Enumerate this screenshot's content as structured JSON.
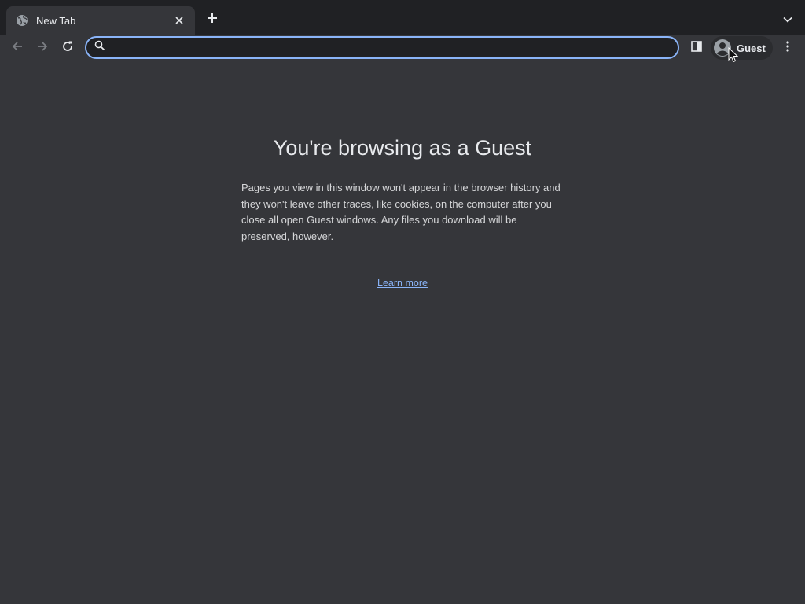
{
  "tabs": [
    {
      "title": "New Tab",
      "favicon_icon": "globe-icon",
      "close_icon": "close-icon",
      "active": true
    }
  ],
  "tabstrip": {
    "new_tab_icon": "plus-icon",
    "tab_search_icon": "chevron-down-icon"
  },
  "toolbar": {
    "back_icon": "arrow-left-icon",
    "forward_icon": "arrow-right-icon",
    "reload_icon": "reload-icon",
    "omnibox": {
      "icon": "search-icon",
      "value": "",
      "placeholder": ""
    },
    "side_panel_icon": "side-panel-icon",
    "profile": {
      "icon": "account-circle-icon",
      "label": "Guest"
    },
    "menu_icon": "more-vert-icon"
  },
  "content": {
    "heading": "You're browsing as a Guest",
    "description": "Pages you view in this window won't appear in the browser history and they won't leave other traces, like cookies, on the computer after you close all open Guest windows. Any files you download will be preserved, however.",
    "learn_more": "Learn more"
  },
  "colors": {
    "frame": "#202124",
    "toolbar": "#35363a",
    "accent": "#8ab4f8",
    "text": "#e8eaed"
  }
}
